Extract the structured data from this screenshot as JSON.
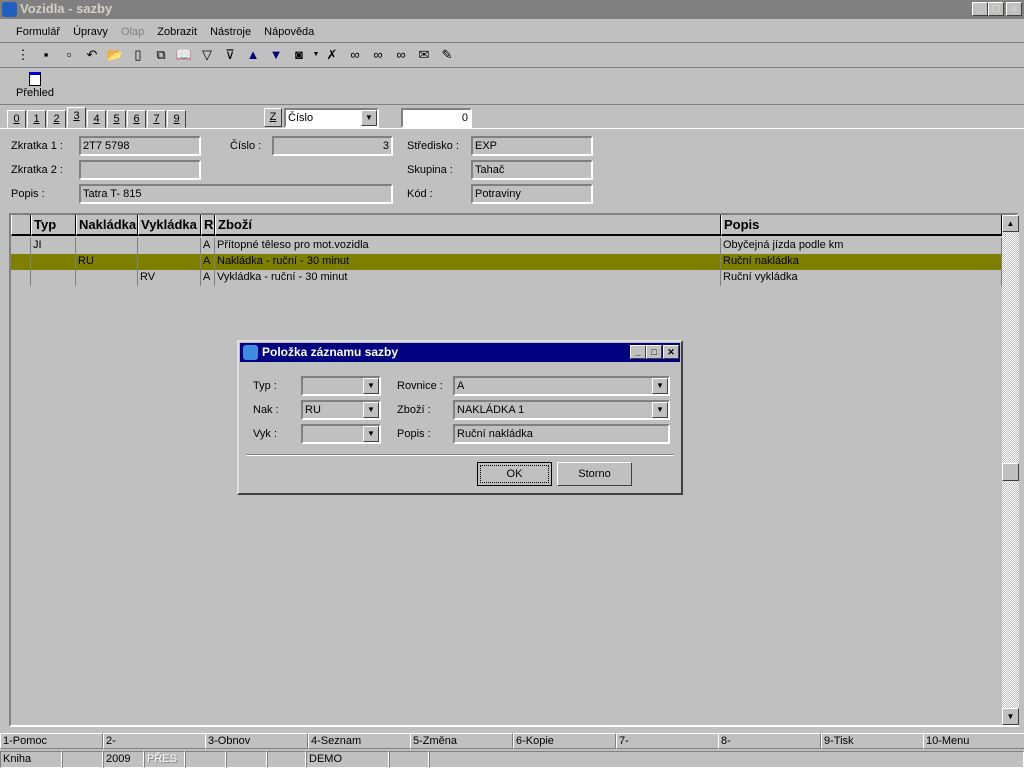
{
  "window": {
    "title": "Vozidla - sazby"
  },
  "menu": [
    "Formulář",
    "Úpravy",
    "Olap",
    "Zobrazit",
    "Nástroje",
    "Nápověda"
  ],
  "toolbar_icons": [
    "tree-icon",
    "save-icon",
    "save-as-icon",
    "undo-icon",
    "open-folder-icon",
    "new-doc-icon",
    "copy-icon",
    "book-icon",
    "filter-icon",
    "filter-doc-icon",
    "arrow-up-icon",
    "arrow-down-icon",
    "camera-icon",
    "excel-icon",
    "binoculars-icon",
    "find-prev-icon",
    "find-next-icon",
    "mail-icon",
    "edit-doc-icon"
  ],
  "overview": {
    "label": "Přehled"
  },
  "tabs": [
    "0",
    "1",
    "2",
    "3",
    "4",
    "5",
    "6",
    "7",
    "9"
  ],
  "active_tab": "3",
  "sort": {
    "button": "Z",
    "field": "Číslo",
    "value": "0"
  },
  "form": {
    "zkratka1_label": "Zkratka 1 :",
    "zkratka1": "2T7 5798",
    "zkratka2_label": "Zkratka 2 :",
    "zkratka2": "",
    "popis_label": "Popis :",
    "popis": "Tatra T- 815",
    "cislo_label": "Číslo :",
    "cislo": "3",
    "stredisko_label": "Středisko :",
    "stredisko": "EXP",
    "skupina_label": "Skupina :",
    "skupina": "Tahač",
    "kod_label": "Kód :",
    "kod": "Potraviny"
  },
  "grid": {
    "columns": [
      "Typ",
      "Nakládka",
      "Vykládka",
      "R",
      "Zboží",
      "Popis"
    ],
    "rows": [
      [
        "JI",
        "",
        "",
        "A",
        "Přítopné těleso pro mot.vozidla",
        "Obyčejná jízda podle km"
      ],
      [
        "",
        "RU",
        "",
        "A",
        "Nakládka - ruční - 30 minut",
        "Ruční nakládka"
      ],
      [
        "",
        "",
        "RV",
        "A",
        "Vykládka - ruční - 30 minut",
        "Ruční vykládka"
      ]
    ],
    "selected_row": 1,
    "highlight_color": "#808000"
  },
  "dialog": {
    "title": "Položka záznamu sazby",
    "typ_label": "Typ :",
    "typ": "",
    "nak_label": "Nak :",
    "nak": "RU",
    "vyk_label": "Vyk :",
    "vyk": "",
    "rovnice_label": "Rovnice :",
    "rovnice": "A",
    "zbozi_label": "Zboží :",
    "zbozi": "NAKLÁDKA 1",
    "popis_label": "Popis :",
    "popis": "Ruční nakládka",
    "ok": "OK",
    "storno": "Storno"
  },
  "fkeys": [
    "1-Pomoc",
    "2-",
    "3-Obnov",
    "4-Seznam",
    "5-Změna",
    "6-Kopie",
    "7-",
    "8-",
    "9-Tisk",
    "10-Menu"
  ],
  "status": [
    "Kniha",
    "",
    "2009",
    "PŘES",
    "",
    "",
    "",
    "DEMO",
    "",
    ""
  ]
}
